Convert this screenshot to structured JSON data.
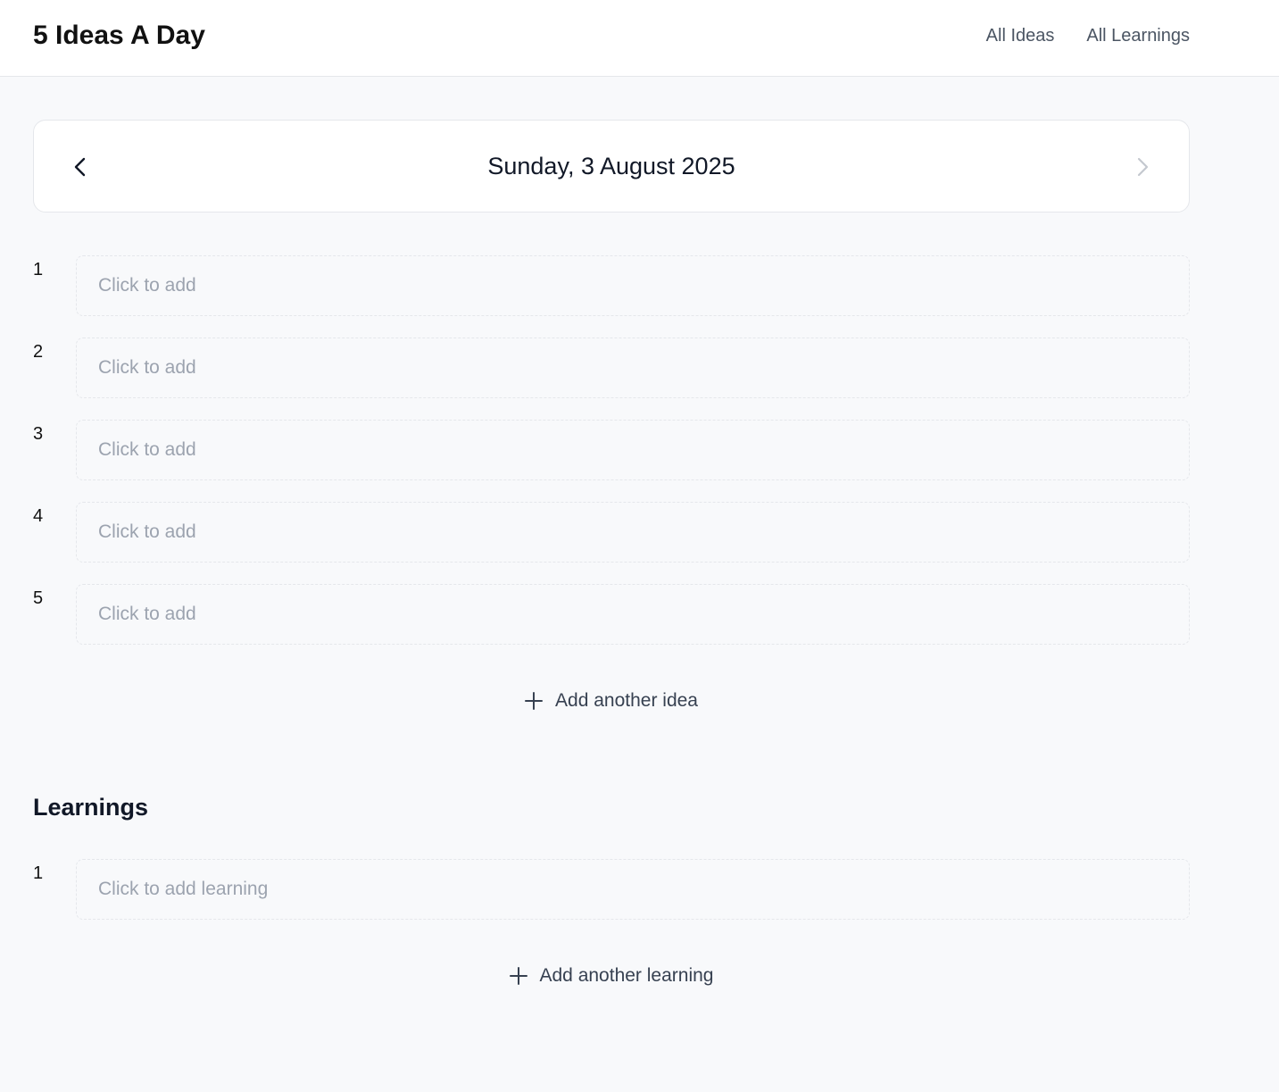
{
  "header": {
    "title": "5 Ideas A Day",
    "nav": [
      {
        "label": "All Ideas"
      },
      {
        "label": "All Learnings"
      }
    ]
  },
  "date_nav": {
    "date": "Sunday, 3 August 2025",
    "prev_icon": "chevron-left-icon",
    "next_icon": "chevron-right-icon"
  },
  "ideas": [
    {
      "number": "1",
      "placeholder": "Click to add"
    },
    {
      "number": "2",
      "placeholder": "Click to add"
    },
    {
      "number": "3",
      "placeholder": "Click to add"
    },
    {
      "number": "4",
      "placeholder": "Click to add"
    },
    {
      "number": "5",
      "placeholder": "Click to add"
    }
  ],
  "add_idea": {
    "label": "Add another idea",
    "icon": "plus-icon"
  },
  "learnings": {
    "title": "Learnings",
    "items": [
      {
        "number": "1",
        "placeholder": "Click to add learning"
      }
    ],
    "add_label": "Add another learning"
  },
  "colors": {
    "background": "#f8f9fb",
    "card": "#ffffff",
    "border": "#e5e7eb",
    "placeholder": "#9ca3af",
    "nav_text": "#4b5563"
  }
}
